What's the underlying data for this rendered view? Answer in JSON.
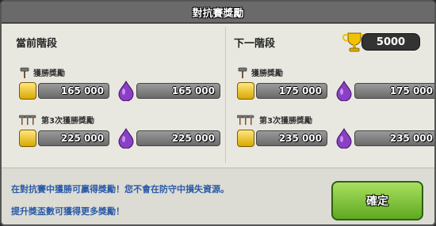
{
  "dialog": {
    "title": "對抗賽獎勵"
  },
  "current": {
    "heading": "當前階段",
    "win_bonus_label": "獲勝獎勵",
    "win_bonus_gold": "165 000",
    "win_bonus_elixir": "165 000",
    "third_win_label": "第3次獲勝獎勵",
    "third_win_gold": "225 000",
    "third_win_elixir": "225 000"
  },
  "next": {
    "heading": "下一階段",
    "trophies": "5000",
    "win_bonus_label": "獲勝獎勵",
    "win_bonus_gold": "175 000",
    "win_bonus_elixir": "175 000",
    "third_win_label": "第3次獲勝獎勵",
    "third_win_gold": "235 000",
    "third_win_elixir": "235 000"
  },
  "footer": {
    "line1": "在對抗賽中獲勝可贏得獎勵！您不會在防守中損失資源。",
    "line2": "提升獎盃數可獲得更多獎勵！",
    "ok_label": "確定"
  },
  "colors": {
    "accent_green": "#5fa822",
    "gold": "#f2c200",
    "elixir": "#8b3fc4",
    "text_blue": "#2a5aa8"
  },
  "icons": [
    "hammer-icon",
    "triple-hammer-icon",
    "gold-icon",
    "elixir-icon",
    "trophy-icon"
  ]
}
